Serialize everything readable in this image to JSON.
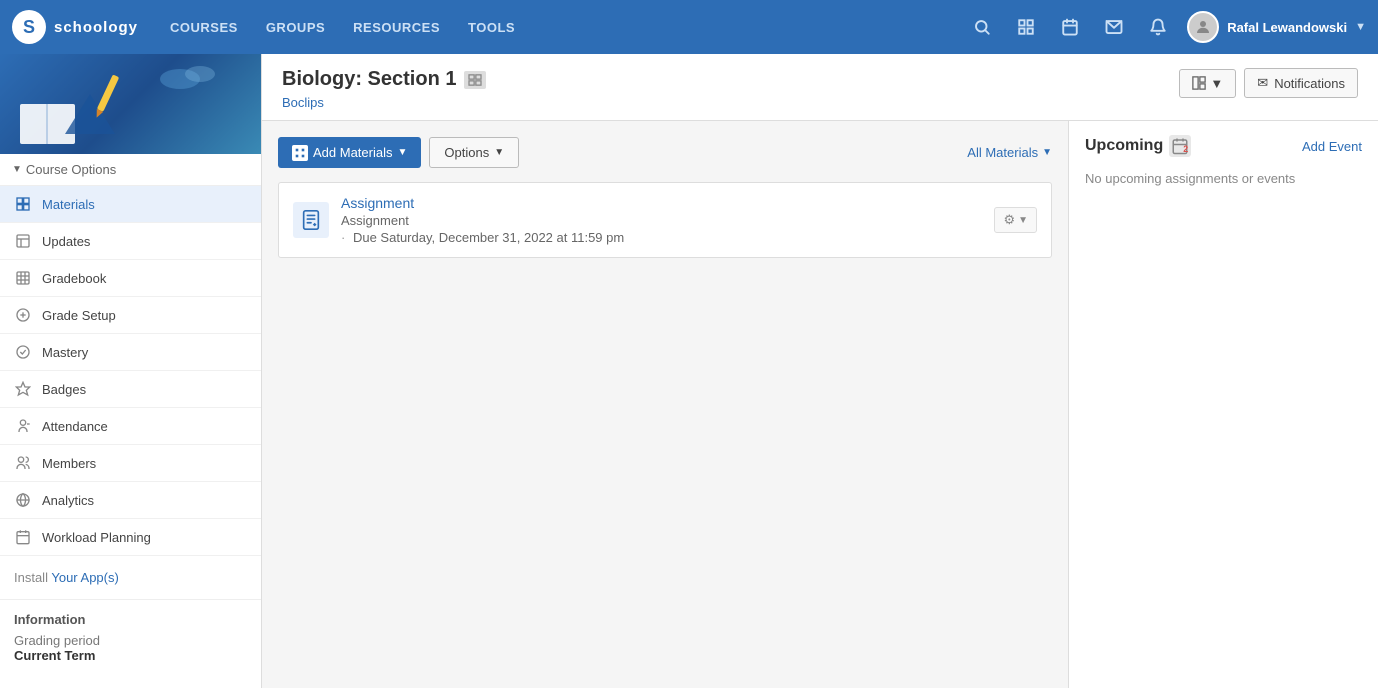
{
  "topNav": {
    "logoText": "schoology",
    "logoS": "S",
    "links": [
      {
        "label": "COURSES",
        "id": "courses"
      },
      {
        "label": "GROUPS",
        "id": "groups"
      },
      {
        "label": "RESOURCES",
        "id": "resources"
      },
      {
        "label": "TOOLS",
        "id": "tools"
      }
    ],
    "userName": "Rafal Lewandowski"
  },
  "sidebar": {
    "courseOptions": "Course Options",
    "items": [
      {
        "id": "materials",
        "label": "Materials",
        "active": true
      },
      {
        "id": "updates",
        "label": "Updates"
      },
      {
        "id": "gradebook",
        "label": "Gradebook"
      },
      {
        "id": "grade-setup",
        "label": "Grade Setup"
      },
      {
        "id": "mastery",
        "label": "Mastery"
      },
      {
        "id": "badges",
        "label": "Badges"
      },
      {
        "id": "attendance",
        "label": "Attendance"
      },
      {
        "id": "members",
        "label": "Members"
      },
      {
        "id": "analytics",
        "label": "Analytics"
      },
      {
        "id": "workload-planning",
        "label": "Workload Planning"
      }
    ],
    "installApps": "Install",
    "installAppsLink": "Your App(s)",
    "information": "Information",
    "gradingPeriodLabel": "Grading period",
    "gradingPeriodValue": "Current Term"
  },
  "courseHeader": {
    "title": "Biology: Section 1",
    "link": "Boclips",
    "notificationsLabel": "Notifications",
    "layoutIcon": "⊞"
  },
  "materialsPanel": {
    "addMaterialsLabel": "Add Materials",
    "optionsLabel": "Options",
    "allMaterialsLabel": "All Materials",
    "items": [
      {
        "title": "Assignment",
        "type": "Assignment",
        "due": "Due Saturday, December 31, 2022 at 11:59 pm"
      }
    ]
  },
  "upcomingPanel": {
    "title": "Upcoming",
    "calendarNum": "2",
    "addEventLabel": "Add Event",
    "noUpcomingText": "No upcoming assignments or events"
  }
}
